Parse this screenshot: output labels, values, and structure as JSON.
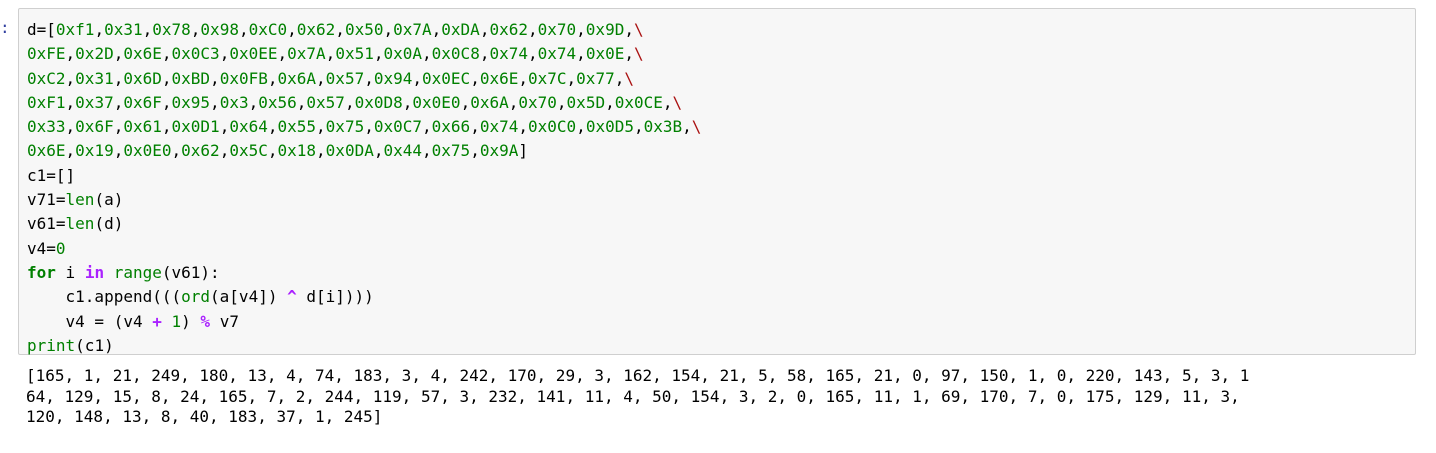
{
  "prompt_marker": ":",
  "code_lines": [
    [
      [
        "t",
        "d=["
      ],
      [
        "n",
        "0xf1"
      ],
      [
        "t",
        ","
      ],
      [
        "n",
        "0x31"
      ],
      [
        "t",
        ","
      ],
      [
        "n",
        "0x78"
      ],
      [
        "t",
        ","
      ],
      [
        "n",
        "0x98"
      ],
      [
        "t",
        ","
      ],
      [
        "n",
        "0xC0"
      ],
      [
        "t",
        ","
      ],
      [
        "n",
        "0x62"
      ],
      [
        "t",
        ","
      ],
      [
        "n",
        "0x50"
      ],
      [
        "t",
        ","
      ],
      [
        "n",
        "0x7A"
      ],
      [
        "t",
        ","
      ],
      [
        "n",
        "0xDA"
      ],
      [
        "t",
        ","
      ],
      [
        "n",
        "0x62"
      ],
      [
        "t",
        ","
      ],
      [
        "n",
        "0x70"
      ],
      [
        "t",
        ","
      ],
      [
        "n",
        "0x9D"
      ],
      [
        "t",
        ","
      ],
      [
        "c",
        "\\"
      ]
    ],
    [
      [
        "n",
        "0xFE"
      ],
      [
        "t",
        ","
      ],
      [
        "n",
        "0x2D"
      ],
      [
        "t",
        ","
      ],
      [
        "n",
        "0x6E"
      ],
      [
        "t",
        ","
      ],
      [
        "n",
        "0x0C3"
      ],
      [
        "t",
        ","
      ],
      [
        "n",
        "0x0EE"
      ],
      [
        "t",
        ","
      ],
      [
        "n",
        "0x7A"
      ],
      [
        "t",
        ","
      ],
      [
        "n",
        "0x51"
      ],
      [
        "t",
        ","
      ],
      [
        "n",
        "0x0A"
      ],
      [
        "t",
        ","
      ],
      [
        "n",
        "0x0C8"
      ],
      [
        "t",
        ","
      ],
      [
        "n",
        "0x74"
      ],
      [
        "t",
        ","
      ],
      [
        "n",
        "0x74"
      ],
      [
        "t",
        ","
      ],
      [
        "n",
        "0x0E"
      ],
      [
        "t",
        ","
      ],
      [
        "c",
        "\\"
      ]
    ],
    [
      [
        "n",
        "0xC2"
      ],
      [
        "t",
        ","
      ],
      [
        "n",
        "0x31"
      ],
      [
        "t",
        ","
      ],
      [
        "n",
        "0x6D"
      ],
      [
        "t",
        ","
      ],
      [
        "n",
        "0xBD"
      ],
      [
        "t",
        ","
      ],
      [
        "n",
        "0x0FB"
      ],
      [
        "t",
        ","
      ],
      [
        "n",
        "0x6A"
      ],
      [
        "t",
        ","
      ],
      [
        "n",
        "0x57"
      ],
      [
        "t",
        ","
      ],
      [
        "n",
        "0x94"
      ],
      [
        "t",
        ","
      ],
      [
        "n",
        "0x0EC"
      ],
      [
        "t",
        ","
      ],
      [
        "n",
        "0x6E"
      ],
      [
        "t",
        ","
      ],
      [
        "n",
        "0x7C"
      ],
      [
        "t",
        ","
      ],
      [
        "n",
        "0x77"
      ],
      [
        "t",
        ","
      ],
      [
        "c",
        "\\"
      ]
    ],
    [
      [
        "n",
        "0xF1"
      ],
      [
        "t",
        ","
      ],
      [
        "n",
        "0x37"
      ],
      [
        "t",
        ","
      ],
      [
        "n",
        "0x6F"
      ],
      [
        "t",
        ","
      ],
      [
        "n",
        "0x95"
      ],
      [
        "t",
        ","
      ],
      [
        "n",
        "0x3"
      ],
      [
        "t",
        ","
      ],
      [
        "n",
        "0x56"
      ],
      [
        "t",
        ","
      ],
      [
        "n",
        "0x57"
      ],
      [
        "t",
        ","
      ],
      [
        "n",
        "0x0D8"
      ],
      [
        "t",
        ","
      ],
      [
        "n",
        "0x0E0"
      ],
      [
        "t",
        ","
      ],
      [
        "n",
        "0x6A"
      ],
      [
        "t",
        ","
      ],
      [
        "n",
        "0x70"
      ],
      [
        "t",
        ","
      ],
      [
        "n",
        "0x5D"
      ],
      [
        "t",
        ","
      ],
      [
        "n",
        "0x0CE"
      ],
      [
        "t",
        ","
      ],
      [
        "c",
        "\\"
      ]
    ],
    [
      [
        "n",
        "0x33"
      ],
      [
        "t",
        ","
      ],
      [
        "n",
        "0x6F"
      ],
      [
        "t",
        ","
      ],
      [
        "n",
        "0x61"
      ],
      [
        "t",
        ","
      ],
      [
        "n",
        "0x0D1"
      ],
      [
        "t",
        ","
      ],
      [
        "n",
        "0x64"
      ],
      [
        "t",
        ","
      ],
      [
        "n",
        "0x55"
      ],
      [
        "t",
        ","
      ],
      [
        "n",
        "0x75"
      ],
      [
        "t",
        ","
      ],
      [
        "n",
        "0x0C7"
      ],
      [
        "t",
        ","
      ],
      [
        "n",
        "0x66"
      ],
      [
        "t",
        ","
      ],
      [
        "n",
        "0x74"
      ],
      [
        "t",
        ","
      ],
      [
        "n",
        "0x0C0"
      ],
      [
        "t",
        ","
      ],
      [
        "n",
        "0x0D5"
      ],
      [
        "t",
        ","
      ],
      [
        "n",
        "0x3B"
      ],
      [
        "t",
        ","
      ],
      [
        "c",
        "\\"
      ]
    ],
    [
      [
        "n",
        "0x6E"
      ],
      [
        "t",
        ","
      ],
      [
        "n",
        "0x19"
      ],
      [
        "t",
        ","
      ],
      [
        "n",
        "0x0E0"
      ],
      [
        "t",
        ","
      ],
      [
        "n",
        "0x62"
      ],
      [
        "t",
        ","
      ],
      [
        "n",
        "0x5C"
      ],
      [
        "t",
        ","
      ],
      [
        "n",
        "0x18"
      ],
      [
        "t",
        ","
      ],
      [
        "n",
        "0x0DA"
      ],
      [
        "t",
        ","
      ],
      [
        "n",
        "0x44"
      ],
      [
        "t",
        ","
      ],
      [
        "n",
        "0x75"
      ],
      [
        "t",
        ","
      ],
      [
        "n",
        "0x9A"
      ],
      [
        "t",
        "]"
      ]
    ],
    [
      [
        "t",
        "c1=[]"
      ]
    ],
    [
      [
        "t",
        "v71="
      ],
      [
        "b",
        "len"
      ],
      [
        "t",
        "(a)"
      ]
    ],
    [
      [
        "t",
        "v61="
      ],
      [
        "b",
        "len"
      ],
      [
        "t",
        "(d)"
      ]
    ],
    [
      [
        "t",
        "v4="
      ],
      [
        "n",
        "0"
      ]
    ],
    [
      [
        "k",
        "for"
      ],
      [
        "t",
        " i "
      ],
      [
        "o",
        "in"
      ],
      [
        "t",
        " "
      ],
      [
        "b",
        "range"
      ],
      [
        "t",
        "(v61):"
      ]
    ],
    [
      [
        "t",
        "    c1.append((("
      ],
      [
        "b",
        "ord"
      ],
      [
        "t",
        "(a[v4]) "
      ],
      [
        "o",
        "^"
      ],
      [
        "t",
        " d[i])))"
      ]
    ],
    [
      [
        "t",
        "    v4 = (v4 "
      ],
      [
        "o",
        "+"
      ],
      [
        "t",
        " "
      ],
      [
        "n",
        "1"
      ],
      [
        "t",
        ") "
      ],
      [
        "o",
        "%"
      ],
      [
        "t",
        " v7"
      ]
    ],
    [
      [
        "b",
        "print"
      ],
      [
        "t",
        "(c1)"
      ]
    ]
  ],
  "output_lines": [
    "[165, 1, 21, 249, 180, 13, 4, 74, 183, 3, 4, 242, 170, 29, 3, 162, 154, 21, 5, 58, 165, 21, 0, 97, 150, 1, 0, 220, 143, 5, 3, 1",
    "64, 129, 15, 8, 24, 165, 7, 2, 244, 119, 57, 3, 232, 141, 11, 4, 50, 154, 3, 2, 0, 165, 11, 1, 69, 170, 7, 0, 175, 129, 11, 3,",
    "120, 148, 13, 8, 40, 183, 37, 1, 245]"
  ]
}
